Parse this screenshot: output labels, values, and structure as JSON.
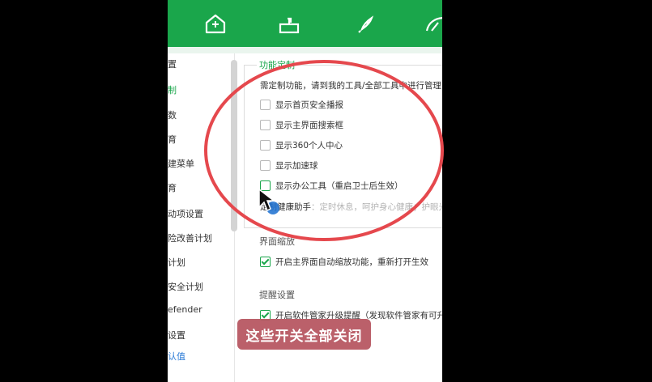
{
  "sidebar": {
    "items": [
      {
        "label": "置",
        "state": "normal"
      },
      {
        "label": "制",
        "state": "active"
      },
      {
        "label": "数",
        "state": "normal"
      },
      {
        "label": "育",
        "state": "normal"
      },
      {
        "label": "建菜单",
        "state": "normal"
      },
      {
        "label": "育",
        "state": "normal"
      },
      {
        "label": "动项设置",
        "state": "normal"
      },
      {
        "label": "险改善计划",
        "state": "normal"
      },
      {
        "label": "计划",
        "state": "normal"
      },
      {
        "label": "安全计划",
        "state": "normal"
      },
      {
        "label": "efender",
        "state": "normal"
      },
      {
        "label": "设置",
        "state": "normal"
      },
      {
        "label": "认值",
        "state": "link"
      }
    ]
  },
  "feature_custom": {
    "title": "功能定制",
    "description": "需定制功能，请到我的工具/全部工具中进行管理",
    "options": [
      {
        "label": "显示首页安全播报",
        "checked": false,
        "note": ""
      },
      {
        "label": "显示主界面搜索框",
        "checked": false,
        "note": ""
      },
      {
        "label": "显示360个人中心",
        "checked": false,
        "note": ""
      },
      {
        "label": "显示加速球",
        "checked": false,
        "note": ""
      },
      {
        "label": "显示办公工具",
        "checked": false,
        "note": "（重启卫士后生效）"
      }
    ],
    "health_text": "定制健康助手",
    "health_faded": "：定时休息，呵护身心健康；护眼光线"
  },
  "ui_zoom": {
    "title": "界面缩放",
    "option": {
      "label": "开启主界面自动缩放功能，重新打开生效",
      "checked": true
    }
  },
  "reminder": {
    "title": "提醒设置",
    "option": {
      "label": "开启软件管家升级提醒（发现软件管家有可升级",
      "checked": true
    }
  },
  "caption": "这些开关全部关闭",
  "colors": {
    "brand_green": "#1aa64b",
    "annotation_red": "#e5484d",
    "caption_bg": "#b85863"
  },
  "icons": [
    "home-shield-icon",
    "toolbox-icon",
    "rocket-icon",
    "speed-icon"
  ]
}
